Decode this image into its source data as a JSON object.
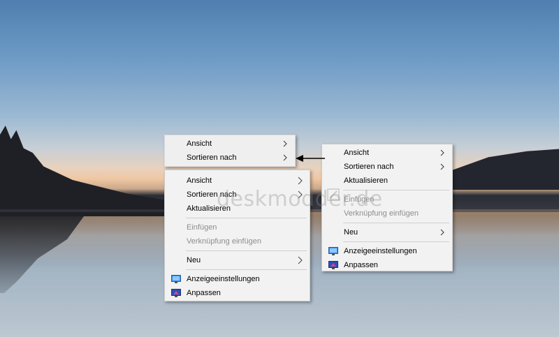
{
  "menus": {
    "compact": {
      "items": [
        "Ansicht",
        "Sortieren nach"
      ]
    },
    "old": {
      "ansicht": "Ansicht",
      "sortieren": "Sortieren nach",
      "aktualisieren": "Aktualisieren",
      "einfuegen": "Einfügen",
      "verknuepfung": "Verknüpfung einfügen",
      "neu": "Neu",
      "anzeige": "Anzeigeeinstellungen",
      "anpassen": "Anpassen"
    },
    "new": {
      "ansicht": "Ansicht",
      "sortieren": "Sortieren nach",
      "aktualisieren": "Aktualisieren",
      "einfuegen": "Einfügen",
      "verknuepfung": "Verknüpfung einfügen",
      "neu": "Neu",
      "anzeige": "Anzeigeeinstellungen",
      "anpassen": "Anpassen"
    }
  },
  "watermark": "deskmodder.de",
  "icons": {
    "submenu": "chevron-right-icon",
    "display": "display-settings-icon",
    "personalize": "personalize-icon",
    "pointer": "left-arrow-icon"
  },
  "colors": {
    "menu_bg": "#f2f2f2",
    "disabled_text": "#8d8d8d",
    "separator": "#cfcfcf"
  }
}
